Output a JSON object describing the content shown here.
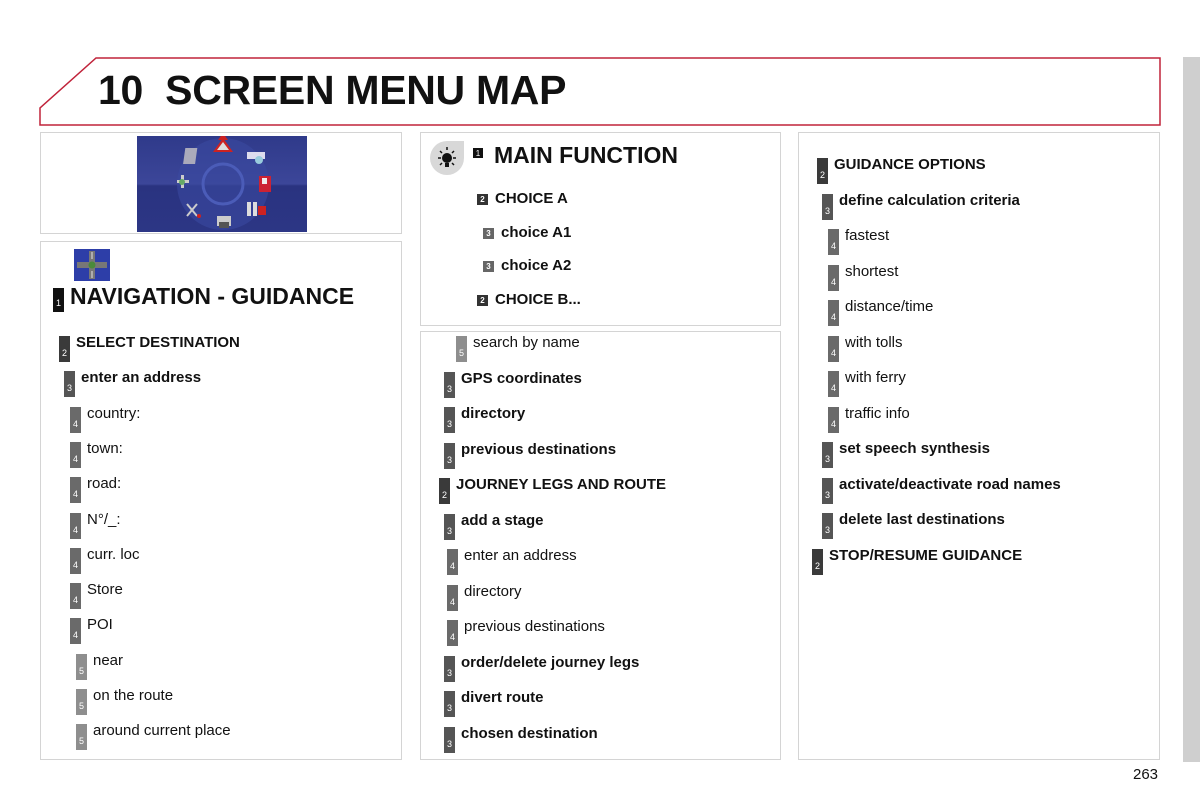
{
  "header": {
    "title": "10  SCREEN MENU MAP",
    "accent_color": "#c0233a"
  },
  "page_number": "263",
  "screen_image": {
    "icon": "navigation-menu-screen-icon",
    "description": "Multimedia menu wheel screenshot"
  },
  "navigation": {
    "icon": "intersection-navigation-icon",
    "title": {
      "level": "1",
      "label": "NAVIGATION - GUIDANCE"
    },
    "items": [
      {
        "level": "2",
        "label": "SELECT DESTINATION",
        "bold": true
      },
      {
        "level": "3",
        "label": "enter an address",
        "bold": true
      },
      {
        "level": "4",
        "label": "country:"
      },
      {
        "level": "4",
        "label": "town:"
      },
      {
        "level": "4",
        "label": "road:"
      },
      {
        "level": "4",
        "label": "N°/_:"
      },
      {
        "level": "4",
        "label": "curr. loc"
      },
      {
        "level": "4",
        "label": "Store"
      },
      {
        "level": "4",
        "label": "POI"
      },
      {
        "level": "5",
        "label": "near"
      },
      {
        "level": "5",
        "label": "on the route"
      },
      {
        "level": "5",
        "label": "around current place"
      }
    ]
  },
  "main_function": {
    "icon": "lamp-icon",
    "level": "1",
    "title": "MAIN FUNCTION",
    "items": [
      {
        "level": "2",
        "label": "CHOICE A"
      },
      {
        "level": "3",
        "label": "choice A1"
      },
      {
        "level": "3",
        "label": "choice A2"
      },
      {
        "level": "2",
        "label": "CHOICE B..."
      }
    ]
  },
  "middle": {
    "items": [
      {
        "level": "5",
        "label": "search by name"
      },
      {
        "level": "3",
        "label": "GPS coordinates",
        "bold": true
      },
      {
        "level": "3",
        "label": "directory",
        "bold": true
      },
      {
        "level": "3",
        "label": "previous destinations",
        "bold": true
      },
      {
        "level": "2",
        "label": "JOURNEY LEGS AND ROUTE",
        "bold": true
      },
      {
        "level": "3",
        "label": "add a stage",
        "bold": true
      },
      {
        "level": "4",
        "label": "enter an address"
      },
      {
        "level": "4",
        "label": "directory"
      },
      {
        "level": "4",
        "label": "previous destinations"
      },
      {
        "level": "3",
        "label": "order/delete journey legs",
        "bold": true
      },
      {
        "level": "3",
        "label": "divert route",
        "bold": true
      },
      {
        "level": "3",
        "label": "chosen destination",
        "bold": true
      }
    ]
  },
  "right": {
    "items": [
      {
        "level": "2",
        "label": "GUIDANCE OPTIONS",
        "bold": true
      },
      {
        "level": "3",
        "label": "define calculation criteria",
        "bold": true
      },
      {
        "level": "4",
        "label": "fastest"
      },
      {
        "level": "4",
        "label": "shortest"
      },
      {
        "level": "4",
        "label": "distance/time"
      },
      {
        "level": "4",
        "label": "with tolls"
      },
      {
        "level": "4",
        "label": "with ferry"
      },
      {
        "level": "4",
        "label": "traffic info"
      },
      {
        "level": "3",
        "label": "set speech synthesis",
        "bold": true
      },
      {
        "level": "3",
        "label": "activate/deactivate road names",
        "bold": true
      },
      {
        "level": "3",
        "label": "delete last destinations",
        "bold": true
      },
      {
        "level": "2",
        "label": "STOP/RESUME GUIDANCE",
        "bold": true
      }
    ]
  }
}
